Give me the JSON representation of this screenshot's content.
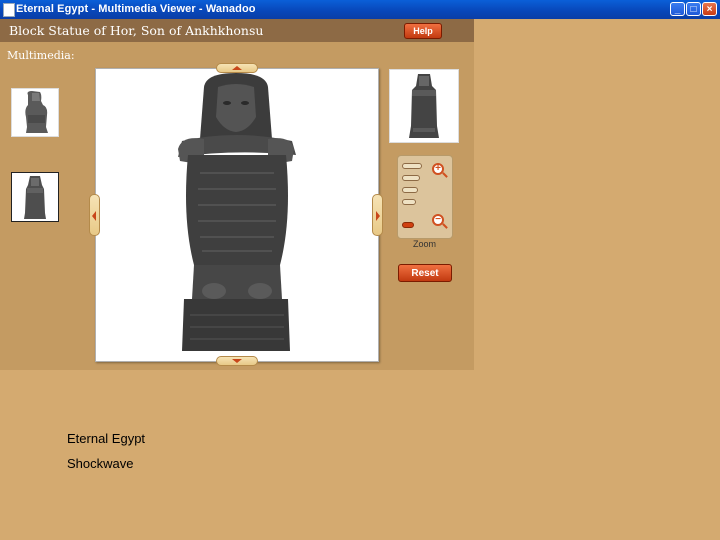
{
  "window": {
    "title": "Eternal Egypt - Multimedia Viewer - Wanadoo",
    "minimize_glyph": "_",
    "maximize_glyph": "□",
    "close_glyph": "×"
  },
  "viewer": {
    "heading": "Block Statue of Hor, Son of Ankhkhonsu",
    "help_label": "Help",
    "multimedia_label": "Multimedia:",
    "zoom_label": "Zoom",
    "reset_label": "Reset",
    "zoom_level": 1,
    "zoom_levels": 5
  },
  "captions": {
    "line1": "Eternal Egypt",
    "line2": "Shockwave"
  },
  "colors": {
    "accent": "#c8461a",
    "viewer_bg": "#c49b62",
    "header_bg": "#8d6a45",
    "page_bg": "#d4aa70"
  }
}
